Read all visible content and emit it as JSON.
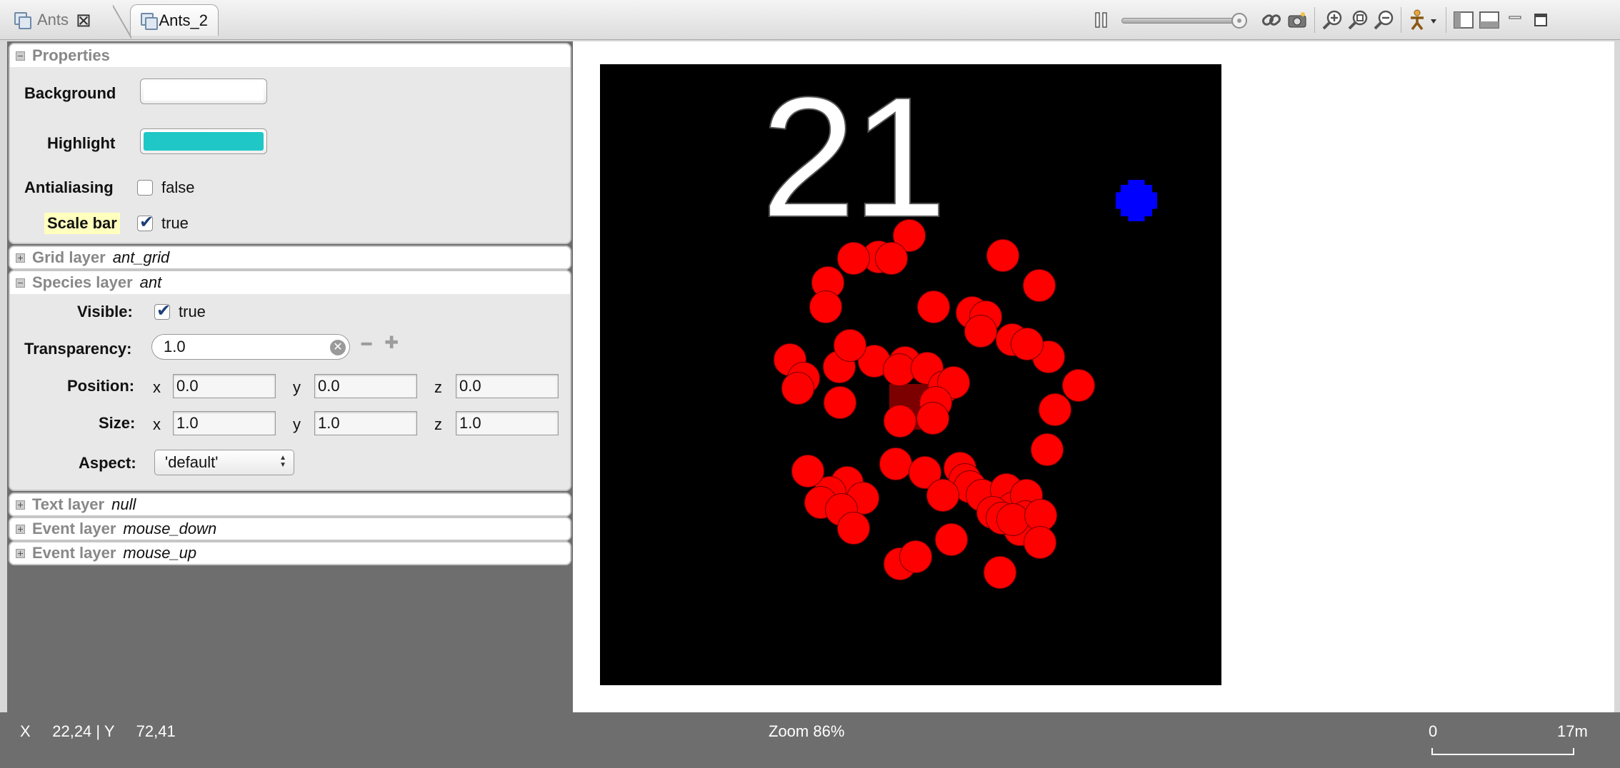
{
  "tabs": [
    {
      "label": "Ants",
      "active": false
    },
    {
      "label": "Ants_2",
      "active": true
    }
  ],
  "toolbar": {
    "icons": [
      "pause-icon",
      "speed-slider",
      "link-icon",
      "camera-icon",
      "zoom-in-icon",
      "zoom-fit-icon",
      "zoom-out-icon",
      "person-menu-icon",
      "layout-side-icon",
      "layout-top-icon",
      "minimize-icon",
      "maximize-icon"
    ],
    "speed_level": 1.0
  },
  "properties": {
    "title": "Properties",
    "background_label": "Background",
    "background_color": "#ffffff",
    "highlight_label": "Highlight",
    "highlight_color": "#1fc7c7",
    "antialiasing_label": "Antialiasing",
    "antialiasing_value": "false",
    "scalebar_label": "Scale bar",
    "scalebar_value": "true"
  },
  "layers": {
    "grid": {
      "kind": "Grid layer",
      "name": "ant_grid"
    },
    "species": {
      "kind": "Species layer",
      "name": "ant",
      "visible_label": "Visible:",
      "visible_value": "true",
      "transparency_label": "Transparency:",
      "transparency_value": "1.0",
      "position_label": "Position:",
      "position": {
        "x": "0.0",
        "y": "0.0",
        "z": "0.0"
      },
      "size_label": "Size:",
      "size": {
        "x": "1.0",
        "y": "1.0",
        "z": "1.0"
      },
      "aspect_label": "Aspect:",
      "aspect_value": "'default'"
    },
    "text": {
      "kind": "Text layer",
      "name": "null"
    },
    "event_down": {
      "kind": "Event layer",
      "name": "mouse_down"
    },
    "event_up": {
      "kind": "Event layer",
      "name": "mouse_up"
    }
  },
  "axes": {
    "x": "x",
    "y": "y",
    "z": "z"
  },
  "simulation": {
    "counter": "21",
    "ant_color": "#ff0000",
    "nest_color": "#7d0000",
    "food_color": "#0000ff",
    "background": "#000000"
  },
  "status": {
    "coords": "X     22,24 | Y     72,41",
    "zoom": "Zoom 86%",
    "scale_start": "0",
    "scale_end": "17m"
  }
}
